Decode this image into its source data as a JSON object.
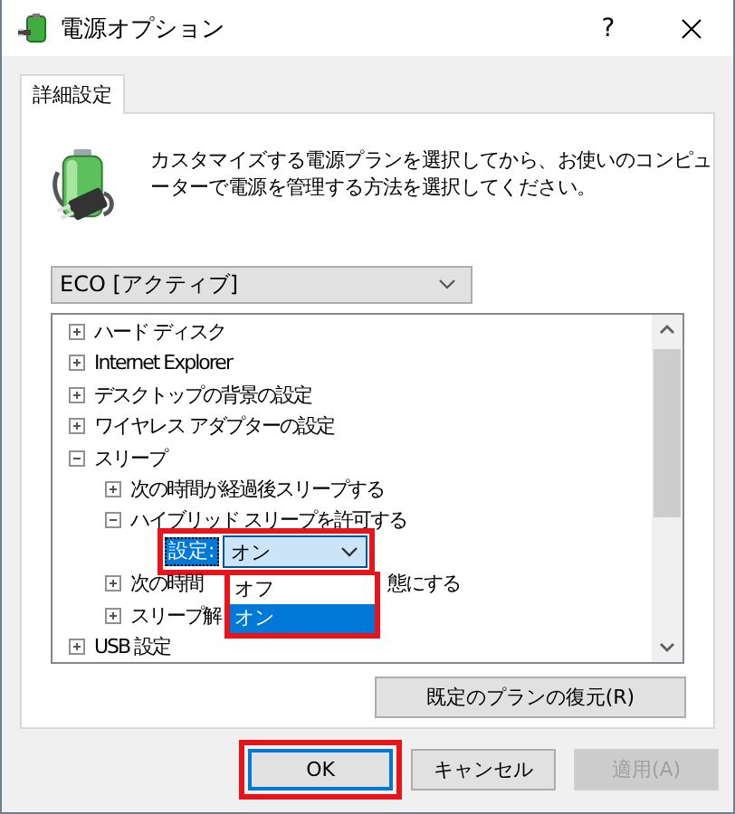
{
  "window": {
    "title": "電源オプション",
    "help": "?"
  },
  "tabs": [
    {
      "label": "詳細設定",
      "selected": true
    }
  ],
  "description": "カスタマイズする電源プランを選択してから、お使いのコンピューターで電源を管理する方法を選択してください。",
  "plan_select": {
    "value": "ECO [アクティブ]"
  },
  "tree": [
    {
      "label": "ハード ディスク",
      "expanded": false
    },
    {
      "label": "Internet Explorer",
      "expanded": false
    },
    {
      "label": "デスクトップの背景の設定",
      "expanded": false
    },
    {
      "label": "ワイヤレス アダプターの設定",
      "expanded": false
    },
    {
      "label": "スリープ",
      "expanded": true,
      "children": [
        {
          "label": "次の時間が経過後スリープする",
          "expanded": false
        },
        {
          "label": "ハイブリッド スリープを許可する",
          "expanded": true,
          "children": [
            {
              "kind": "setting",
              "label": "設定:",
              "value": "オン",
              "open": true,
              "highlighted": true,
              "options": [
                {
                  "label": "オフ",
                  "selected": false
                },
                {
                  "label": "オン",
                  "selected": true
                }
              ]
            }
          ]
        },
        {
          "label": "次の時間",
          "label_tail": "態にする",
          "expanded": false
        },
        {
          "label": "スリープ解",
          "expanded": false
        }
      ]
    },
    {
      "label": "USB 設定",
      "expanded": false
    }
  ],
  "restore_button": {
    "label": "既定のプランの復元(R)"
  },
  "buttons": [
    {
      "label": "OK",
      "kind": "default",
      "highlighted": true,
      "disabled": false
    },
    {
      "label": "キャンセル",
      "kind": "normal",
      "highlighted": false,
      "disabled": false
    },
    {
      "label": "適用(A)",
      "kind": "normal",
      "highlighted": false,
      "disabled": true
    }
  ]
}
